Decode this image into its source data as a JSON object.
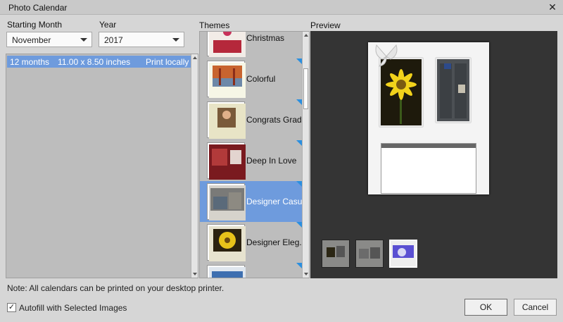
{
  "window": {
    "title": "Photo Calendar"
  },
  "starting_month": {
    "label": "Starting Month",
    "value": "November"
  },
  "year": {
    "label": "Year",
    "value": "2017"
  },
  "size_list": {
    "rows": [
      {
        "months": "12 months",
        "size": "11.00 x 8.50 inches",
        "destination": "Print locally"
      }
    ]
  },
  "themes": {
    "label": "Themes",
    "items": [
      {
        "name": "Christmas"
      },
      {
        "name": "Colorful"
      },
      {
        "name": "Congrats Grad..."
      },
      {
        "name": "Deep In Love"
      },
      {
        "name": "Designer Casual"
      },
      {
        "name": "Designer Eleg..."
      },
      {
        "name": ""
      }
    ],
    "selected_index": 4
  },
  "preview": {
    "label": "Preview"
  },
  "note": "Note: All calendars can be printed on your desktop printer.",
  "autofill": {
    "label": "Autofill with Selected Images",
    "checked": true
  },
  "buttons": {
    "ok": "OK",
    "cancel": "Cancel"
  },
  "colors": {
    "selection": "#6e9bdd",
    "panel": "#bdbdbd",
    "preview_bg": "#343434",
    "accent": "#2a8fe0"
  }
}
